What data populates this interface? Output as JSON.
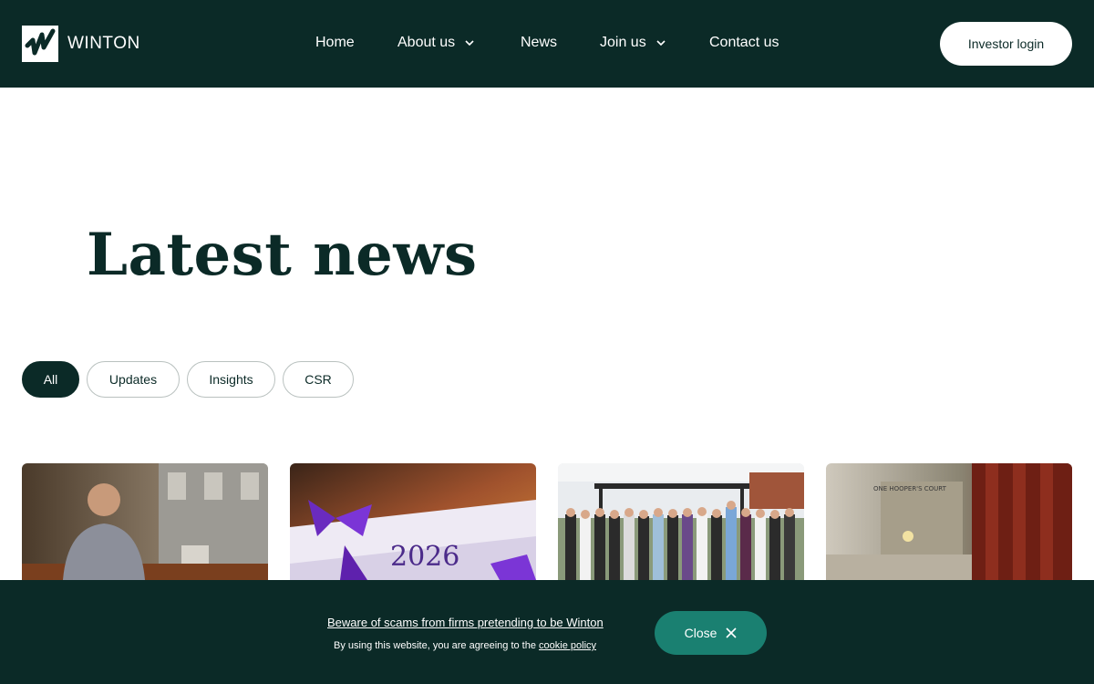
{
  "brand": {
    "name": "WINTON"
  },
  "nav": {
    "home": "Home",
    "about": "About us",
    "news": "News",
    "join": "Join us",
    "contact": "Contact us"
  },
  "header": {
    "investor_login": "Investor login"
  },
  "main": {
    "title": "Latest news",
    "filters": [
      "All",
      "Updates",
      "Insights",
      "CSR"
    ],
    "active_filter": "All"
  },
  "cards": [
    {
      "image": "man-seated-in-office-photo"
    },
    {
      "image": "2026-diploma-scrolls-photo",
      "image_text": "2026"
    },
    {
      "image": "team-group-photo-rooftop"
    },
    {
      "image": "hoopers-court-hallway-photo",
      "image_text": "ONE HOOPER'S COURT"
    }
  ],
  "cookie": {
    "scam_warning": "Beware of scams from firms pretending to be Winton",
    "notice_prefix": "By using this website, you are agreeing to the",
    "policy_link": "cookie policy",
    "close": "Close"
  },
  "colors": {
    "brand_dark": "#0b2a27",
    "accent_teal": "#1a8071",
    "white": "#ffffff"
  }
}
